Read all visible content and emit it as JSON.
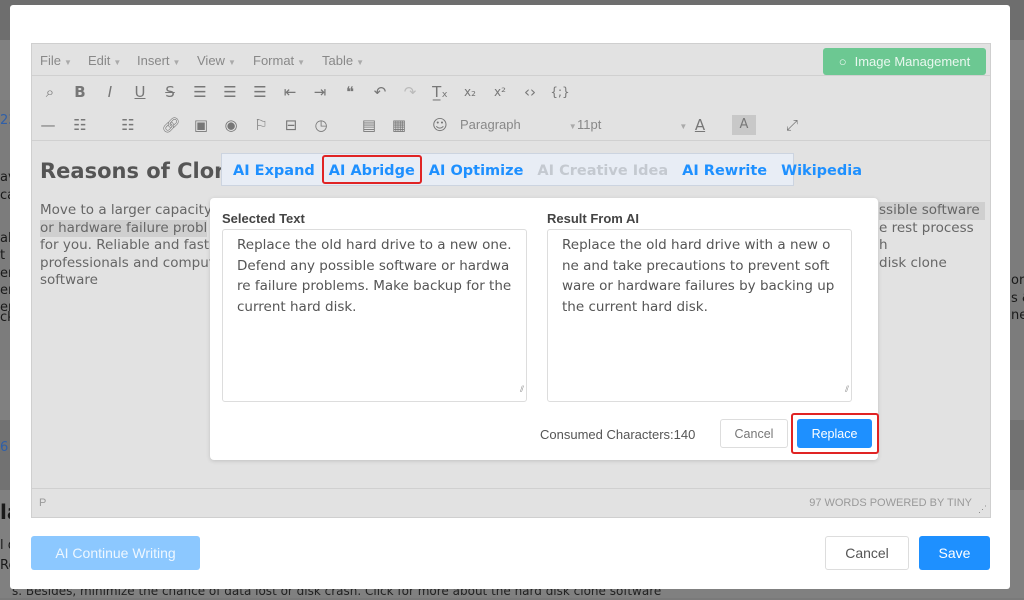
{
  "background": {
    "left_fragments": [
      "23",
      "av",
      "ca",
      "al (",
      "t h",
      "en",
      "en",
      "er",
      "ck",
      "6",
      "la",
      "l d",
      "Re"
    ],
    "right_fragments": [
      "or",
      "s &",
      "ne"
    ],
    "bottom_line": "s. Besides, minimize the chance of data lost or disk crash. Click for more about the hard disk clone software"
  },
  "editor": {
    "menu": [
      "File",
      "Edit",
      "Insert",
      "View",
      "Format",
      "Table"
    ],
    "image_management_label": "Image Management",
    "toolbar_row1": [
      "find-replace-icon",
      "bold-icon",
      "italic-icon",
      "underline-icon",
      "strikethrough-icon",
      "align-left-icon",
      "align-center-icon",
      "align-right-icon",
      "outdent-icon",
      "indent-icon",
      "blockquote-icon",
      "undo-icon",
      "redo-icon",
      "clear-format-icon",
      "subscript-icon",
      "superscript-icon",
      "code-icon",
      "code-sample-icon"
    ],
    "toolbar_row2": [
      "horizontal-rule-icon",
      "bullet-list-icon",
      "numbered-list-icon",
      "link-icon",
      "image-icon",
      "preview-icon",
      "bookmark-icon",
      "page-break-icon",
      "clock-icon",
      "media-icon",
      "table-icon",
      "emoji-icon",
      "text-color-icon",
      "highlight-color-icon",
      "fullscreen-icon"
    ],
    "block_format": "Paragraph",
    "font_size": "11pt",
    "heading": "Reasons of Clon",
    "paragraph_left": [
      "Move to a larger capacity",
      "or hardware failure probl",
      "for you. Reliable and fast",
      "professionals and comput",
      "software"
    ],
    "paragraph_right": [
      "ssible software",
      "e rest process",
      "h",
      "disk clone",
      ""
    ],
    "status_path": "P",
    "status_right": "97 WORDS POWERED BY TINY"
  },
  "ai_bar": {
    "items": [
      {
        "label": "AI Expand",
        "state": "enabled"
      },
      {
        "label": "AI Abridge",
        "state": "selected"
      },
      {
        "label": "AI Optimize",
        "state": "enabled"
      },
      {
        "label": "AI Creative Idea",
        "state": "disabled"
      },
      {
        "label": "AI Rewrite",
        "state": "enabled"
      },
      {
        "label": "Wikipedia",
        "state": "enabled"
      }
    ]
  },
  "ai_popup": {
    "selected_label": "Selected Text",
    "selected_text": "Replace the old hard drive to a new one. Defend any possible software or hardware failure problems. Make backup for the current hard disk.",
    "result_label": "Result From AI",
    "result_text": "Replace the old hard drive with a new one and take precautions to prevent software or hardware failures by backing up the current hard disk.",
    "consumed": "Consumed Characters:140",
    "cancel_label": "Cancel",
    "replace_label": "Replace"
  },
  "footer": {
    "continue_label": "AI Continue Writing",
    "cancel_label": "Cancel",
    "save_label": "Save"
  },
  "colors": {
    "accent": "#1e90ff",
    "image_mgmt": "#6cc892",
    "highlight_outline": "#e02424",
    "disabled_continue": "#8cc8ff"
  }
}
